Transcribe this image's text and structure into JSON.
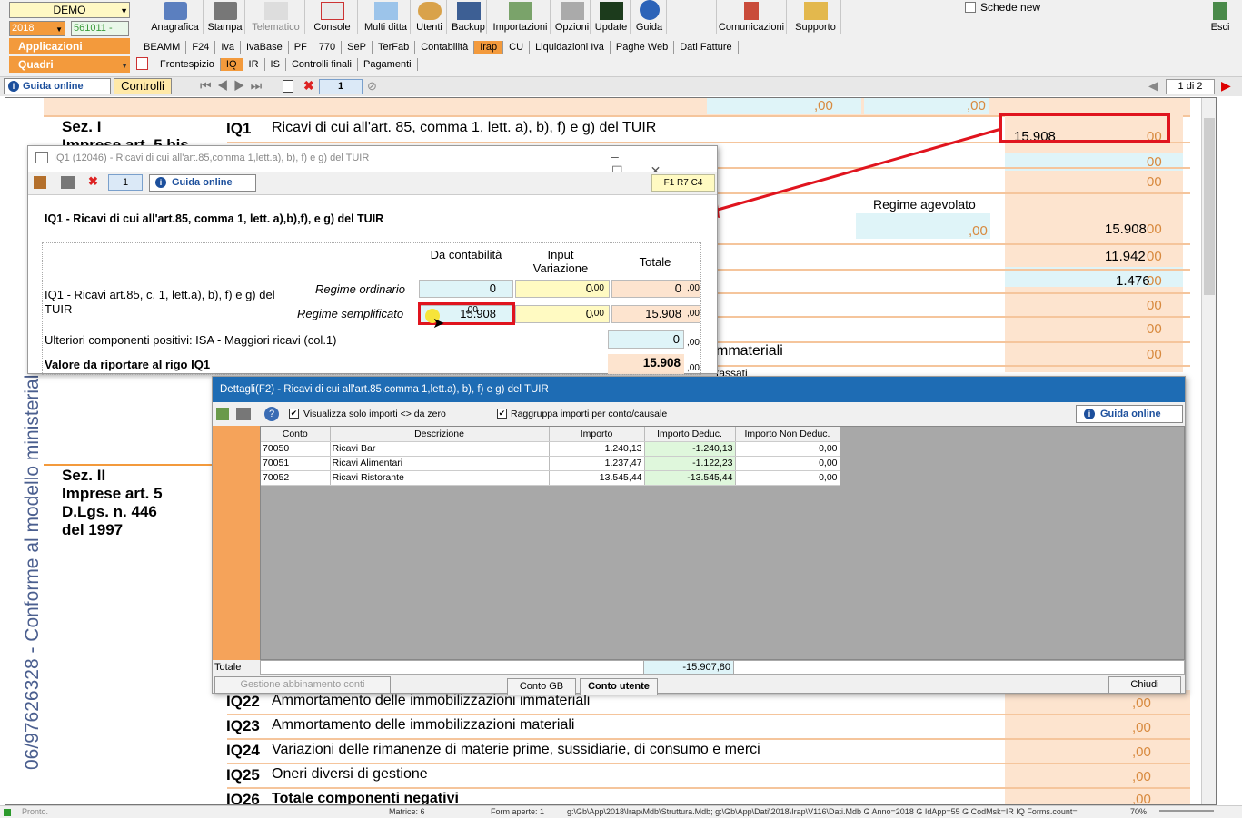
{
  "top": {
    "company": "DEMO",
    "year": "2018",
    "code": "561011 -",
    "applicazioni": "Applicazioni",
    "quadri": "Quadri",
    "schede_new": "Schede new",
    "esci": "Esci"
  },
  "toolbar": [
    "Anagrafica",
    "Stampa",
    "Telematico",
    "Console",
    "Multi ditta",
    "Utenti",
    "Backup",
    "Importazioni",
    "Opzioni",
    "Update",
    "Guida",
    "Comunicazioni",
    "Supporto"
  ],
  "tabs": [
    "BEAMM",
    "F24",
    "Iva",
    "IvaBase",
    "PF",
    "770",
    "SeP",
    "TerFab",
    "Contabilità",
    "Irap",
    "CU",
    "Liquidazioni Iva",
    "Paghe Web",
    "Dati Fatture"
  ],
  "subtabs": [
    "Frontespizio",
    "IQ",
    "IR",
    "IS",
    "Controlli finali",
    "Pagamenti"
  ],
  "nav": {
    "guida": "Guida online",
    "controlli": "Controlli",
    "page": "1",
    "pages": "1 di 2"
  },
  "form": {
    "sez1": "Sez. I",
    "sez1b": "Imprese art. 5 bis",
    "sez2": [
      "Sez. II",
      "Imprese art. 5",
      "D.Lgs. n. 446",
      "del 1997"
    ],
    "vertical": "06/97626328 - Conforme al modello ministeriale",
    "regime": "Regime agevolato",
    "iq1_code": "IQ1",
    "iq1_desc": "Ricavi di cui all'art. 85, comma 1, lett. a), b), f) e g) del TUIR",
    "values": [
      "15.908",
      "15.908",
      "11.942",
      "1.476"
    ],
    "zero": "00",
    "zero_dec": ",00",
    "frag1": "mmateriali",
    "frag2": "tassati",
    "lines": [
      {
        "code": "IQ22",
        "desc": "Ammortamento delle immobilizzazioni immateriali"
      },
      {
        "code": "IQ23",
        "desc": "Ammortamento delle immobilizzazioni materiali"
      },
      {
        "code": "IQ24",
        "desc": "Variazioni delle rimanenze di materie prime, sussidiarie, di consumo e merci"
      },
      {
        "code": "IQ25",
        "desc": "Oneri diversi di gestione"
      },
      {
        "code": "IQ26",
        "desc": "Totale componenti negativi"
      }
    ]
  },
  "dlg1": {
    "title": "IQ1 (12046) - Ricavi di cui all'art.85,comma 1,lett.a), b), f) e g) del TUIR",
    "page": "1",
    "guida": "Guida online",
    "code": "F1 R7 C4",
    "heading": "IQ1 - Ricavi di cui all'art.85, comma 1, lett. a),b),f), e g) del TUIR",
    "cols": [
      "Da contabilità",
      "Input Variazione",
      "Totale"
    ],
    "rowlabel": "IQ1  - Ricavi art.85, c. 1, lett.a), b), f) e g) del TUIR",
    "ordinario": "Regime ordinario",
    "semplificato": "Regime semplificato",
    "ord": [
      "0",
      "0",
      "0"
    ],
    "sem": [
      "15.908",
      "0",
      "15.908"
    ],
    "isa": "Ulteriori componenti positivi: ISA - Maggiori ricavi (col.1)",
    "isa_val": "0",
    "riporto": "Valore da riportare al rigo IQ1",
    "riporto_val": "15.908",
    "dec": ",00"
  },
  "dlg2": {
    "title": "Dettagli(F2) - Ricavi di cui all'art.85,comma 1,lett.a), b), f) e g) del TUIR",
    "chk1": "Visualizza solo importi <> da zero",
    "chk2": "Raggruppa importi per conto/causale",
    "guida": "Guida online",
    "headers": [
      "Conto",
      "Descrizione",
      "Importo",
      "Importo Deduc.",
      "Importo Non Deduc."
    ],
    "rows": [
      [
        "70050",
        "Ricavi Bar",
        "1.240,13",
        "-1.240,13",
        "0,00"
      ],
      [
        "70051",
        "Ricavi Alimentari",
        "1.237,47",
        "-1.122,23",
        "0,00"
      ],
      [
        "70052",
        "Ricavi Ristorante",
        "13.545,44",
        "-13.545,44",
        "0,00"
      ]
    ],
    "totale": "Totale",
    "totale_val": "-15.907,80",
    "btn_gestione": "Gestione abbinamento conti",
    "btn_gb": "Conto GB",
    "btn_utente": "Conto utente",
    "btn_chiudi": "Chiudi"
  },
  "status": {
    "pronto": "Pronto.",
    "matrice": "Matrice: 6",
    "form": "Form aperte: 1",
    "path": "g:\\Gb\\App\\2018\\Irap\\Mdb\\Struttura.Mdb; g:\\Gb\\App\\Dati\\2018\\Irap\\V116\\Dati.Mdb G  Anno=2018 G  IdApp=55 G  CodMsk=IR  IQ Forms.count=",
    "zoom": "70%"
  }
}
